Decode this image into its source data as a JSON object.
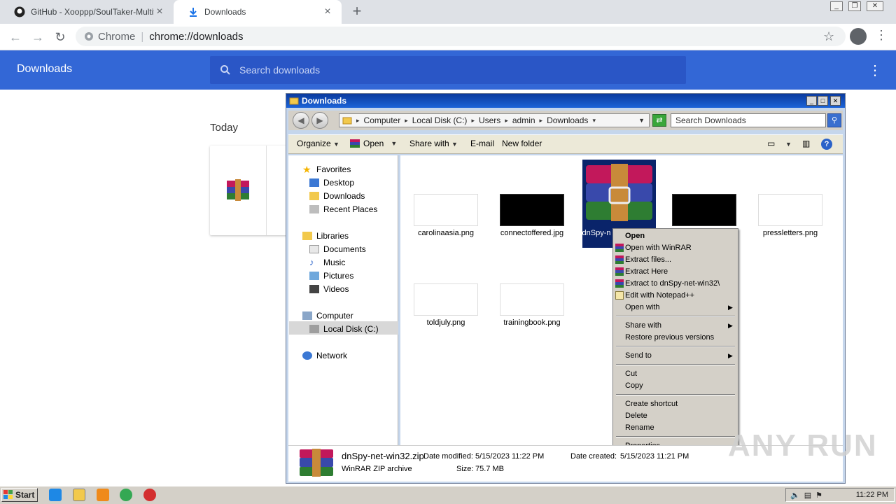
{
  "browser": {
    "tabs": [
      {
        "label": "GitHub - Xooppp/SoulTaker-Multitool",
        "active": false
      },
      {
        "label": "Downloads",
        "active": true
      }
    ],
    "omnibox": {
      "site": "Chrome",
      "url": "chrome://downloads"
    }
  },
  "downloads_page": {
    "title": "Downloads",
    "search_placeholder": "Search downloads",
    "section": "Today"
  },
  "explorer": {
    "title": "Downloads",
    "breadcrumb": [
      "Computer",
      "Local Disk (C:)",
      "Users",
      "admin",
      "Downloads"
    ],
    "search_placeholder": "Search Downloads",
    "commands": {
      "organize": "Organize",
      "open": "Open",
      "share_with": "Share with",
      "email": "E-mail",
      "new_folder": "New folder"
    },
    "nav": {
      "favorites": "Favorites",
      "desktop": "Desktop",
      "downloads": "Downloads",
      "recent": "Recent Places",
      "libraries": "Libraries",
      "documents": "Documents",
      "music": "Music",
      "pictures": "Pictures",
      "videos": "Videos",
      "computer": "Computer",
      "local_disk": "Local Disk (C:)",
      "network": "Network"
    },
    "files": [
      {
        "name": "carolinaasia.png",
        "dark": false
      },
      {
        "name": "connectoffered.jpg",
        "dark": true
      },
      {
        "name": "dnSpy-n",
        "dark": false,
        "selected": true
      },
      {
        "name": "",
        "dark": true
      },
      {
        "name": "pressletters.png",
        "dark": false
      },
      {
        "name": "toldjuly.png",
        "dark": false
      },
      {
        "name": "trainingbook.png",
        "dark": false
      }
    ],
    "context_menu": {
      "open": "Open",
      "open_winrar": "Open with WinRAR",
      "extract_files": "Extract files...",
      "extract_here": "Extract Here",
      "extract_to": "Extract to dnSpy-net-win32\\",
      "edit_npp": "Edit with Notepad++",
      "open_with": "Open with",
      "share_with": "Share with",
      "restore": "Restore previous versions",
      "send_to": "Send to",
      "cut": "Cut",
      "copy": "Copy",
      "create_shortcut": "Create shortcut",
      "delete": "Delete",
      "rename": "Rename",
      "properties": "Properties"
    },
    "details": {
      "filename": "dnSpy-net-win32.zip",
      "type": "WinRAR ZIP archive",
      "modified_label": "Date modified:",
      "modified": "5/15/2023 11:22 PM",
      "created_label": "Date created:",
      "created": "5/15/2023 11:21 PM",
      "size_label": "Size:",
      "size": "75.7 MB"
    }
  },
  "taskbar": {
    "start": "Start",
    "clock": "11:22 PM"
  },
  "watermark": "ANY RUN",
  "colors": {
    "chrome_header": "#3367d6",
    "xp_title": "#0a3a9e",
    "selection": "#0a246a"
  }
}
